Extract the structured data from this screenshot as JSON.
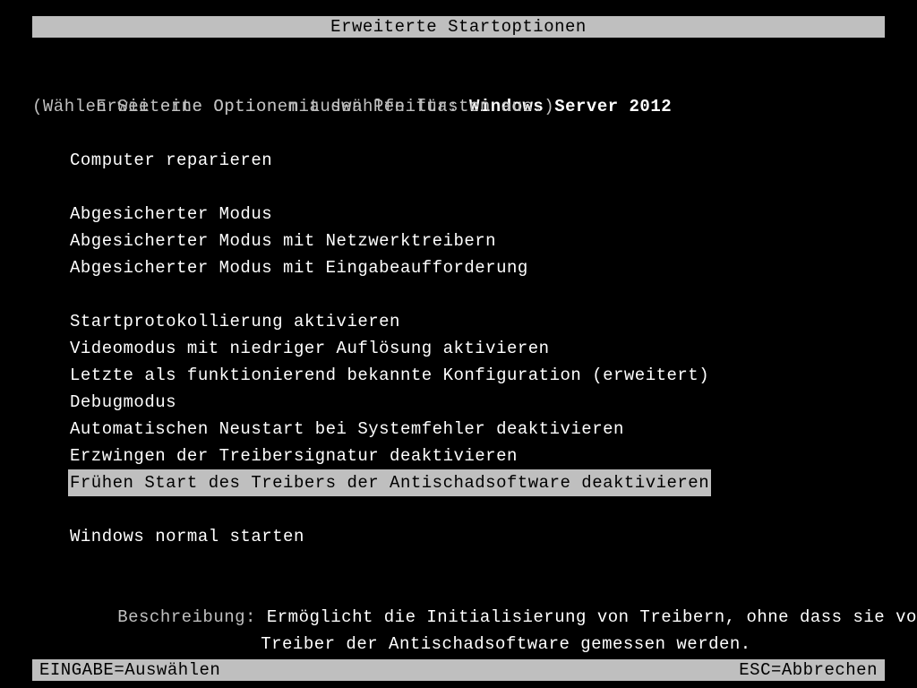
{
  "title": "Erweiterte Startoptionen",
  "header": {
    "prompt_prefix": "Erweiterte Optionen auswählen für: ",
    "os_name": "Windows Server 2012",
    "instruction": "(Wählen Sie eine Option mit den Pfeiltasten aus.)"
  },
  "options": {
    "group1": [
      "Computer reparieren"
    ],
    "group2": [
      "Abgesicherter Modus",
      "Abgesicherter Modus mit Netzwerktreibern",
      "Abgesicherter Modus mit Eingabeaufforderung"
    ],
    "group3": [
      "Startprotokollierung aktivieren",
      "Videomodus mit niedriger Auflösung aktivieren",
      "Letzte als funktionierend bekannte Konfiguration (erweitert)",
      "Debugmodus",
      "Automatischen Neustart bei Systemfehler deaktivieren",
      "Erzwingen der Treibersignatur deaktivieren",
      "Frühen Start des Treibers der Antischadsoftware deaktivieren"
    ],
    "group4": [
      "Windows normal starten"
    ],
    "selected_index_group3": 6
  },
  "description": {
    "label": "Beschreibung: ",
    "text_line1": "Ermöglicht die Initialisierung von Treibern, ohne dass sie vom",
    "text_line2": "Treiber der Antischadsoftware gemessen werden."
  },
  "footer": {
    "enter": "EINGABE=Auswählen",
    "esc": "ESC=Abbrechen"
  }
}
